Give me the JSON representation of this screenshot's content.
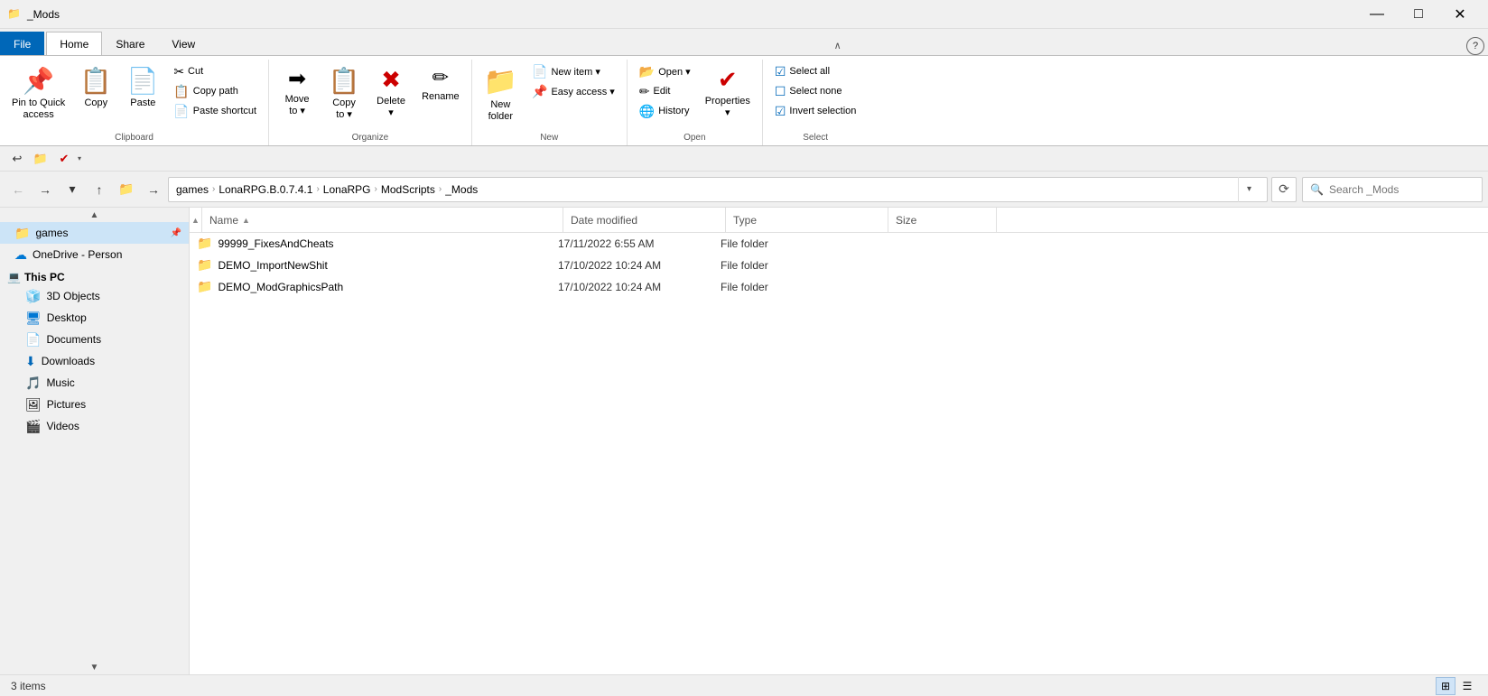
{
  "window": {
    "title": "_Mods",
    "icon": "📁"
  },
  "titlebar": {
    "minimize": "—",
    "maximize": "□",
    "close": "✕"
  },
  "ribbon_tabs": [
    {
      "id": "file",
      "label": "File",
      "class": "file-tab"
    },
    {
      "id": "home",
      "label": "Home",
      "class": "active"
    },
    {
      "id": "share",
      "label": "Share"
    },
    {
      "id": "view",
      "label": "View"
    }
  ],
  "ribbon": {
    "groups": [
      {
        "id": "clipboard",
        "label": "Clipboard",
        "items": [
          {
            "id": "pin-quick",
            "type": "large",
            "icon": "📌",
            "label": "Pin to Quick\naccess"
          },
          {
            "id": "copy",
            "type": "large",
            "icon": "📋",
            "label": "Copy"
          },
          {
            "id": "paste",
            "type": "large",
            "icon": "📄",
            "label": "Paste"
          },
          {
            "id": "clipboard-sub",
            "type": "col",
            "items": [
              {
                "id": "cut",
                "icon": "✂",
                "label": "Cut"
              },
              {
                "id": "copy-path",
                "icon": "📋",
                "label": "Copy path"
              },
              {
                "id": "paste-shortcut",
                "icon": "📄",
                "label": "Paste shortcut"
              }
            ]
          }
        ]
      },
      {
        "id": "organize",
        "label": "Organize",
        "items": [
          {
            "id": "move-to",
            "type": "large",
            "icon": "➡",
            "label": "Move\nto ▾"
          },
          {
            "id": "copy-to",
            "type": "large",
            "icon": "📋",
            "label": "Copy\nto ▾"
          },
          {
            "id": "delete",
            "type": "large",
            "icon": "✖",
            "label": "Delete\n▾"
          },
          {
            "id": "rename",
            "type": "large",
            "icon": "✏",
            "label": "Rename"
          }
        ]
      },
      {
        "id": "new",
        "label": "New",
        "items": [
          {
            "id": "new-folder",
            "type": "large",
            "icon": "📁",
            "label": "New\nfolder"
          },
          {
            "id": "new-sub",
            "type": "col",
            "items": [
              {
                "id": "new-item",
                "icon": "📄",
                "label": "New item ▾"
              },
              {
                "id": "easy-access",
                "icon": "📌",
                "label": "Easy access ▾"
              }
            ]
          }
        ]
      },
      {
        "id": "open",
        "label": "Open",
        "items": [
          {
            "id": "open-col",
            "type": "col",
            "items": [
              {
                "id": "open-btn",
                "icon": "📂",
                "label": "Open ▾"
              },
              {
                "id": "edit-btn",
                "icon": "✏",
                "label": "Edit"
              },
              {
                "id": "history-btn",
                "icon": "🌐",
                "label": "History"
              }
            ]
          },
          {
            "id": "properties",
            "type": "large",
            "icon": "✔",
            "label": "Properties\n▾"
          }
        ]
      },
      {
        "id": "select",
        "label": "Select",
        "items": [
          {
            "id": "select-col",
            "type": "col",
            "items": [
              {
                "id": "select-all",
                "icon": "☑",
                "label": "Select all"
              },
              {
                "id": "select-none",
                "icon": "☐",
                "label": "Select none"
              },
              {
                "id": "invert-selection",
                "icon": "☑",
                "label": "Invert selection"
              }
            ]
          }
        ]
      }
    ]
  },
  "quick_access": {
    "items": [
      {
        "id": "qa-back",
        "icon": "←",
        "tooltip": "Back"
      },
      {
        "id": "qa-folder",
        "icon": "📁",
        "tooltip": "Folder"
      },
      {
        "id": "qa-undo",
        "icon": "↩",
        "tooltip": "Undo"
      }
    ],
    "dropdown": "▾"
  },
  "nav": {
    "back": "←",
    "forward": "→",
    "dropdown": "▾",
    "up": "↑",
    "folder": "📁",
    "forward2": "→",
    "path": [
      {
        "seg": "games"
      },
      {
        "sep": "›"
      },
      {
        "seg": "LonaRPG.B.0.7.4.1"
      },
      {
        "sep": "›"
      },
      {
        "seg": "LonaRPG"
      },
      {
        "sep": "›"
      },
      {
        "seg": "ModScripts"
      },
      {
        "sep": "›"
      },
      {
        "seg": "_Mods"
      }
    ],
    "dropdown_arrow": "▾",
    "refresh": "⟳",
    "search_placeholder": "Search _Mods"
  },
  "sidebar": {
    "items": [
      {
        "id": "games",
        "icon": "📁",
        "label": "games",
        "pinned": true,
        "active": true
      },
      {
        "id": "onedrive",
        "icon": "☁",
        "label": "OneDrive - Person"
      },
      {
        "id": "this-pc",
        "icon": "💻",
        "label": "This PC",
        "section": true
      },
      {
        "id": "3d-objects",
        "icon": "🧊",
        "label": "3D Objects",
        "indent": true
      },
      {
        "id": "desktop",
        "icon": "🖥",
        "label": "Desktop",
        "indent": true
      },
      {
        "id": "documents",
        "icon": "📄",
        "label": "Documents",
        "indent": true
      },
      {
        "id": "downloads",
        "icon": "⬇",
        "label": "Downloads",
        "indent": true
      },
      {
        "id": "music",
        "icon": "🎵",
        "label": "Music",
        "indent": true
      },
      {
        "id": "pictures",
        "icon": "🖼",
        "label": "Pictures",
        "indent": true
      },
      {
        "id": "videos",
        "icon": "🎬",
        "label": "Videos",
        "indent": true
      }
    ]
  },
  "content": {
    "columns": [
      {
        "id": "name",
        "label": "Name",
        "sort": "asc"
      },
      {
        "id": "date",
        "label": "Date modified"
      },
      {
        "id": "type",
        "label": "Type"
      },
      {
        "id": "size",
        "label": "Size"
      }
    ],
    "files": [
      {
        "name": "99999_FixesAndCheats",
        "date": "17/11/2022 6:55 AM",
        "type": "File folder",
        "size": ""
      },
      {
        "name": "DEMO_ImportNewShit",
        "date": "17/10/2022 10:24 AM",
        "type": "File folder",
        "size": ""
      },
      {
        "name": "DEMO_ModGraphicsPath",
        "date": "17/10/2022 10:24 AM",
        "type": "File folder",
        "size": ""
      }
    ]
  },
  "status": {
    "item_count": "3 items",
    "view_icons": [
      "⊞",
      "☰"
    ]
  }
}
